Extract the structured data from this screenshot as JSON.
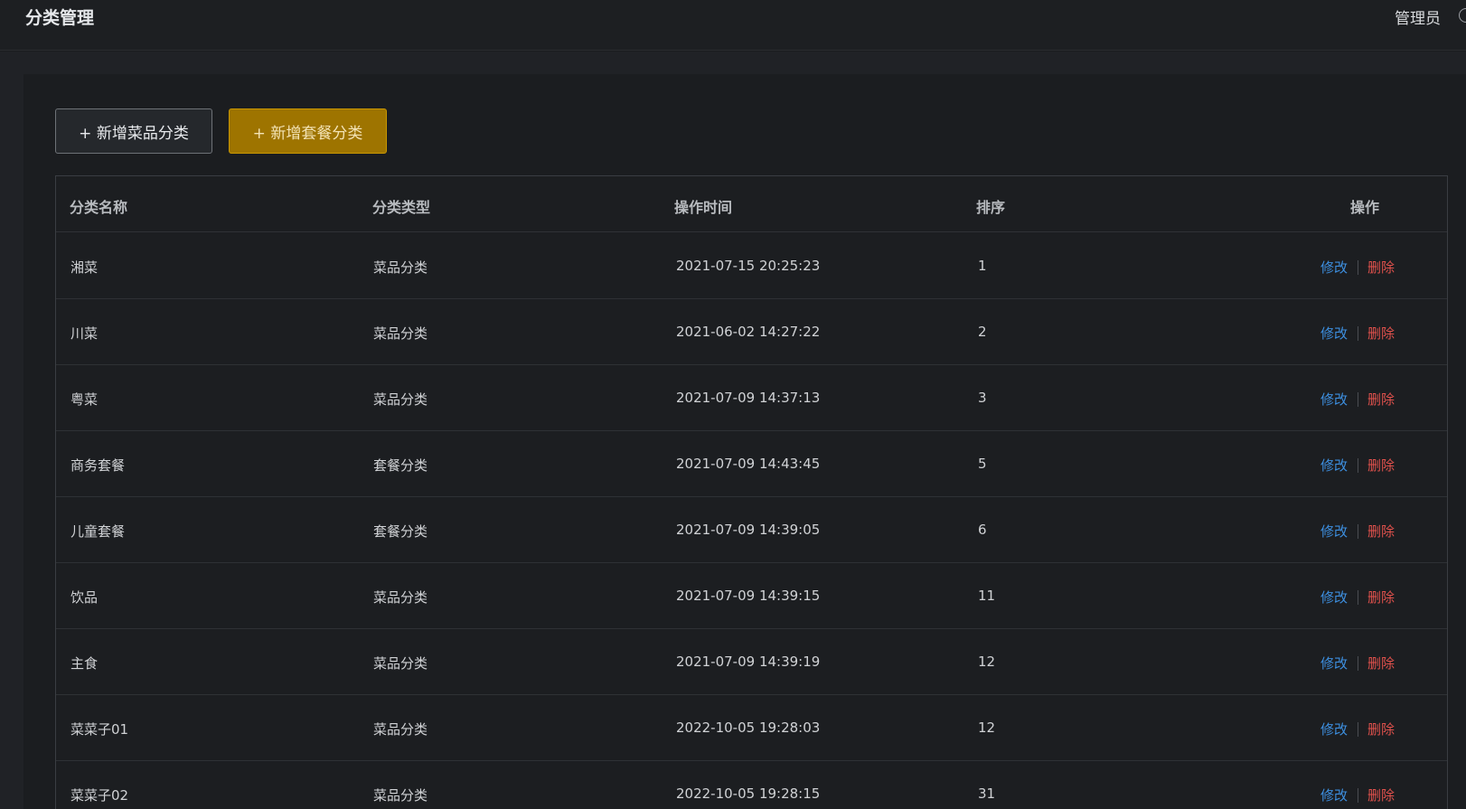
{
  "header": {
    "title": "分类管理",
    "user": "管理员"
  },
  "toolbar": {
    "add_dish_category": "+ 新增菜品分类",
    "add_combo_category": "+ 新增套餐分类"
  },
  "table": {
    "columns": [
      "分类名称",
      "分类类型",
      "操作时间",
      "排序",
      "操作"
    ],
    "rows": [
      {
        "name": "湘菜",
        "type": "菜品分类",
        "time": "2021-07-15 20:25:23",
        "sort": "1"
      },
      {
        "name": "川菜",
        "type": "菜品分类",
        "time": "2021-06-02 14:27:22",
        "sort": "2"
      },
      {
        "name": "粤菜",
        "type": "菜品分类",
        "time": "2021-07-09 14:37:13",
        "sort": "3"
      },
      {
        "name": "商务套餐",
        "type": "套餐分类",
        "time": "2021-07-09 14:43:45",
        "sort": "5"
      },
      {
        "name": "儿童套餐",
        "type": "套餐分类",
        "time": "2021-07-09 14:39:05",
        "sort": "6"
      },
      {
        "name": "饮品",
        "type": "菜品分类",
        "time": "2021-07-09 14:39:15",
        "sort": "11"
      },
      {
        "name": "主食",
        "type": "菜品分类",
        "time": "2021-07-09 14:39:19",
        "sort": "12"
      },
      {
        "name": "菜菜子01",
        "type": "菜品分类",
        "time": "2022-10-05 19:28:03",
        "sort": "12"
      },
      {
        "name": "菜菜子02",
        "type": "菜品分类",
        "time": "2022-10-05 19:28:15",
        "sort": "31"
      }
    ],
    "actions": {
      "edit": "修改",
      "delete": "删除"
    }
  },
  "colors": {
    "accent_button": "#9e7400",
    "edit_link": "#3d8fe0",
    "delete_link": "#e0514c"
  }
}
